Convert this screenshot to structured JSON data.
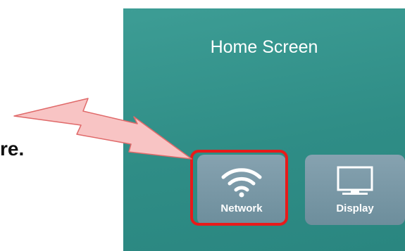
{
  "caption": {
    "fragment": "re."
  },
  "screen": {
    "title": "Home Screen",
    "tiles": [
      {
        "label": "Network",
        "icon": "wifi-icon"
      },
      {
        "label": "Display",
        "icon": "monitor-icon"
      }
    ]
  },
  "annotation": {
    "highlight_color": "#e81a1a",
    "arrow_fill": "#f8c4c4",
    "arrow_stroke": "#e06a6a",
    "target": "Network"
  },
  "colors": {
    "screen_background": "#2f8d86",
    "tile_background": "#7896a4"
  }
}
